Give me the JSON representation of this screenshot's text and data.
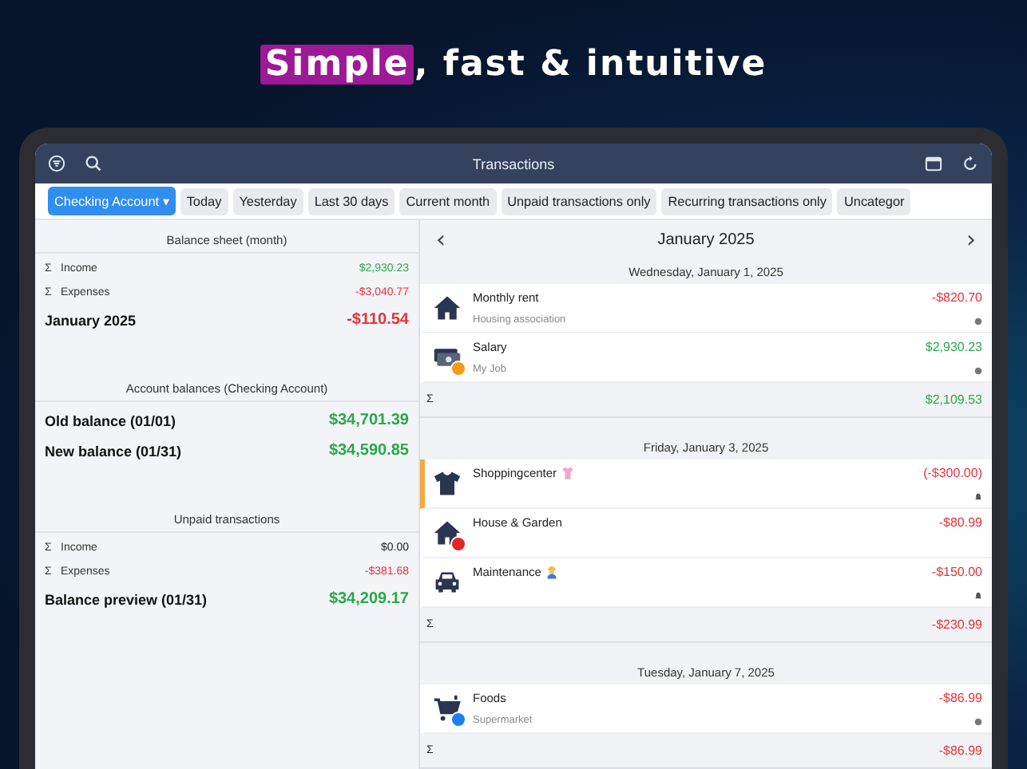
{
  "headline": {
    "highlight": "Simple",
    "rest": ", fast & intuitive"
  },
  "nav": {
    "title": "Transactions"
  },
  "account": {
    "label": "Checking Account",
    "caret": "▾"
  },
  "filters": [
    "Today",
    "Yesterday",
    "Last 30 days",
    "Current month",
    "Unpaid transactions only",
    "Recurring transactions only",
    "Uncategor"
  ],
  "sections": [
    {
      "title": "Balance sheet (month)",
      "rows": [
        {
          "kind": "sum",
          "sigma": "Σ",
          "label": "Income",
          "value": "$2,930.23",
          "color": "#2aa84a"
        },
        {
          "kind": "sum",
          "sigma": "Σ",
          "label": "Expenses",
          "value": "-$3,040.77",
          "color": "#e0353a"
        },
        {
          "kind": "total",
          "label": "January 2025",
          "value": "-$110.54",
          "color": "#e0353a"
        }
      ]
    },
    {
      "title": "Account balances (Checking Account)",
      "rows": [
        {
          "kind": "total",
          "label": "Old balance (01/01)",
          "value": "$34,701.39",
          "color": "#2aa84a"
        },
        {
          "kind": "total",
          "label": "New balance (01/31)",
          "value": "$34,590.85",
          "color": "#2aa84a"
        }
      ]
    },
    {
      "title": "Unpaid transactions",
      "rows": [
        {
          "kind": "sum",
          "sigma": "Σ",
          "label": "Income",
          "value": "$0.00",
          "color": "#222222"
        },
        {
          "kind": "sum",
          "sigma": "Σ",
          "label": "Expenses",
          "value": "-$381.68",
          "color": "#e0353a"
        },
        {
          "kind": "total",
          "label": "Balance preview (01/31)",
          "value": "$34,209.17",
          "color": "#2aa84a"
        }
      ]
    }
  ],
  "month": {
    "prev": "‹",
    "title": "January 2025",
    "next": "›"
  },
  "days": [
    {
      "date": "Wednesday, January 1, 2025",
      "sigma": "Σ",
      "total": "$2,109.53",
      "color": "#2aa84a",
      "transactions": [
        {
          "kind": "house",
          "flagged": false,
          "name": "Monthly rent",
          "note": "Housing association",
          "amount": "-$820.70",
          "color": "#e0353a",
          "status": {
            "kind": "dot"
          }
        },
        {
          "kind": "money",
          "badge": {
            "color": "#f29a1a"
          },
          "flagged": false,
          "name": "Salary",
          "note": "My Job",
          "amount": "$2,930.23",
          "color": "#2aa84a",
          "status": {
            "kind": "dot"
          }
        }
      ]
    },
    {
      "date": "Friday, January 3, 2025",
      "sigma": "Σ",
      "total": "-$230.99",
      "color": "#e0353a",
      "transactions": [
        {
          "kind": "shirt",
          "flagged": true,
          "name": "Shoppingcenter",
          "tag": {
            "kind": "blouse"
          },
          "amount": "(-$300.00)",
          "color": "#e0353a",
          "status": {
            "kind": "bell"
          }
        },
        {
          "kind": "house",
          "badge": {
            "color": "#e0262a"
          },
          "flagged": false,
          "name": "House & Garden",
          "amount": "-$80.99",
          "color": "#e0353a"
        },
        {
          "kind": "car",
          "flagged": false,
          "name": "Maintenance",
          "tag": {
            "kind": "worker"
          },
          "amount": "-$150.00",
          "color": "#e0353a",
          "status": {
            "kind": "bell"
          }
        }
      ]
    },
    {
      "date": "Tuesday, January 7, 2025",
      "sigma": "Σ",
      "total": "-$86.99",
      "color": "#e0353a",
      "transactions": [
        {
          "kind": "cart",
          "badge": {
            "color": "#1a7ff0"
          },
          "flagged": false,
          "name": "Foods",
          "note": "Supermarket",
          "amount": "-$86.99",
          "color": "#e0353a",
          "status": {
            "kind": "dot"
          }
        }
      ]
    }
  ]
}
